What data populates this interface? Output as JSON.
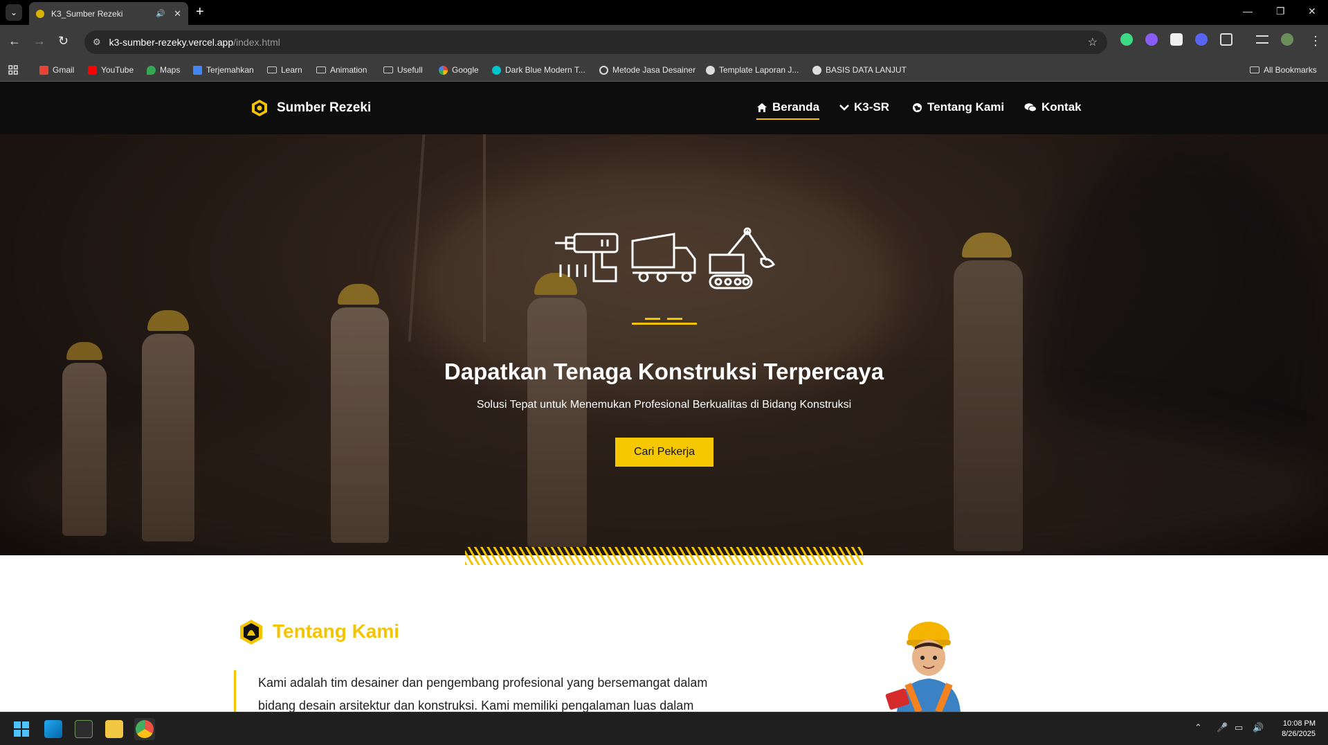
{
  "browser": {
    "tab": {
      "title": "K3_Sumber Rezeki",
      "audio_icon": "speaker-icon",
      "close": "✕"
    },
    "new_tab": "+",
    "window_controls": [
      "—",
      "❐",
      "✕"
    ],
    "nav": {
      "back": "←",
      "forward": "→",
      "reload": "↻"
    },
    "address": {
      "host": "k3-sumber-rezeky.vercel.app",
      "path": "/index.html"
    },
    "bookmarks": [
      {
        "label": "Gmail",
        "icon": "gmail-icon",
        "color": "#ea4335"
      },
      {
        "label": "YouTube",
        "icon": "youtube-icon",
        "color": "#ff0000"
      },
      {
        "label": "Maps",
        "icon": "maps-icon",
        "color": "#34a853"
      },
      {
        "label": "Terjemahkan",
        "icon": "translate-icon",
        "color": "#4285f4"
      },
      {
        "label": "Learn",
        "icon": "folder-icon",
        "color": "#cccccc"
      },
      {
        "label": "Animation",
        "icon": "folder-icon",
        "color": "#cccccc"
      },
      {
        "label": "Usefull",
        "icon": "folder-icon",
        "color": "#cccccc"
      },
      {
        "label": "Google",
        "icon": "google-icon",
        "color": "#4285f4"
      },
      {
        "label": "Dark Blue Modern T...",
        "icon": "canva-icon",
        "color": "#00c4cc"
      },
      {
        "label": "Metode Jasa Desainer",
        "icon": "openai-icon",
        "color": "#dddddd"
      },
      {
        "label": "Template Laporan J...",
        "icon": "globe-icon",
        "color": "#dddddd"
      },
      {
        "label": "BASIS DATA LANJUT",
        "icon": "globe-icon",
        "color": "#dddddd"
      }
    ],
    "all_bookmarks": "All Bookmarks"
  },
  "site": {
    "brand": "Sumber Rezeki",
    "nav": [
      {
        "label": "Beranda",
        "icon": "home-icon",
        "active": true
      },
      {
        "label": "K3-SR",
        "icon": "chevron-down-icon",
        "active": false
      },
      {
        "label": "Tentang Kami",
        "icon": "globe-icon",
        "active": false
      },
      {
        "label": "Kontak",
        "icon": "chat-icon",
        "active": false
      }
    ],
    "hero": {
      "icons": [
        "drill-icon",
        "dump-truck-icon",
        "excavator-icon"
      ],
      "title": "Dapatkan Tenaga Konstruksi Terpercaya",
      "subtitle": "Solusi Tepat untuk Menemukan Profesional Berkualitas di Bidang Konstruksi",
      "cta": "Cari Pekerja"
    },
    "about": {
      "title": "Tentang Kami",
      "text_line1": "Kami adalah tim desainer dan pengembang profesional yang bersemangat dalam",
      "text_line2": "bidang desain arsitektur dan konstruksi. Kami memiliki pengalaman luas dalam"
    },
    "colors": {
      "accent": "#f5c400",
      "nav_bg": "#0d0d0d"
    }
  },
  "taskbar": {
    "apps": [
      "windows-start-icon",
      "vscode-icon",
      "terminal-icon",
      "file-explorer-icon",
      "chrome-icon"
    ],
    "time": "10:08 PM",
    "date": "8/26/2025"
  }
}
